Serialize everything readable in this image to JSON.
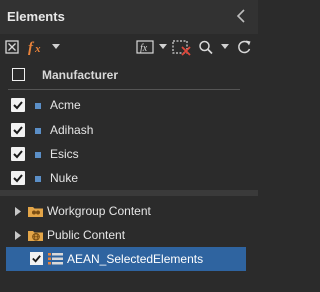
{
  "panel": {
    "title": "Elements",
    "collapse_icon": "chevron-left-icon"
  },
  "toolbar": {
    "icons": [
      "clear-selection-icon",
      "formula-fx-icon",
      "caret-down-icon",
      "formula-box-icon",
      "caret-down-icon",
      "remove-filter-icon",
      "search-icon",
      "caret-down-icon",
      "refresh-icon"
    ]
  },
  "filter_list": {
    "header_label": "Manufacturer",
    "header_checked": false,
    "items": [
      {
        "label": "Acme",
        "checked": true
      },
      {
        "label": "Adihash",
        "checked": true
      },
      {
        "label": "Esics",
        "checked": true
      },
      {
        "label": "Nuke",
        "checked": true
      }
    ]
  },
  "tree": {
    "nodes": [
      {
        "label": "Workgroup Content",
        "icon": "workgroup-folder-icon",
        "expandable": true
      },
      {
        "label": "Public Content",
        "icon": "public-globe-icon",
        "expandable": true
      },
      {
        "label": "AEAN_SelectedElements",
        "icon": "selected-elements-list-icon",
        "checked": true,
        "selected": true
      }
    ]
  },
  "colors": {
    "background": "#2b2b2b",
    "header": "#323232",
    "accent_orange": "#e8823a",
    "accent_blue": "#5b8fc7",
    "selection": "#2f64a0"
  }
}
